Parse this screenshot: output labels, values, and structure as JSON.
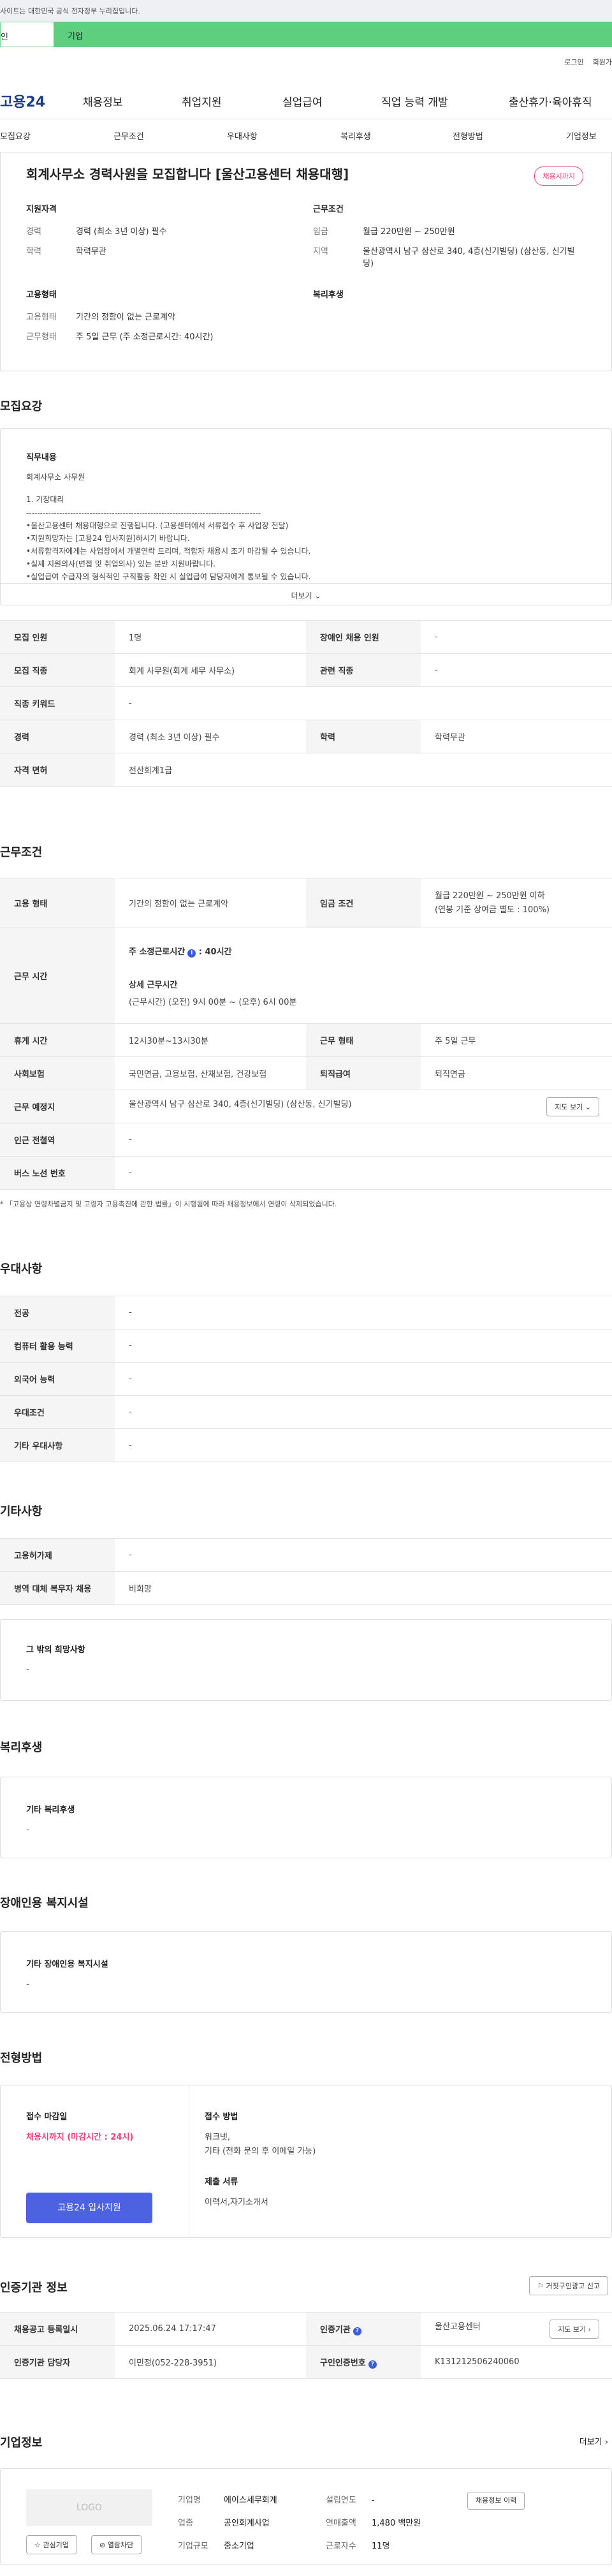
{
  "topbar": {
    "notice": "사이트는 대한민국 공식 전자정부 누리집입니다."
  },
  "tabs": {
    "person": "인",
    "company": "기업"
  },
  "util": {
    "login": "로그인",
    "join": "회원가"
  },
  "gnb": {
    "logo": "고용24",
    "menu": [
      "채용정보",
      "취업지원",
      "실업급여",
      "직업 능력 개발",
      "출산휴가·육아휴직"
    ]
  },
  "subnav": [
    "모집요강",
    "근무조건",
    "우대사항",
    "복리후생",
    "전형방법",
    "기업정보"
  ],
  "summary": {
    "title": "회계사무소 경력사원을 모집합니다 [울산고용센터 채용대행]",
    "badge": "채용시까지",
    "qual": {
      "heading": "지원자격",
      "career_label": "경력",
      "career": "경력 (최소 3년 이상) 필수",
      "edu_label": "학력",
      "edu": "학력무관"
    },
    "cond": {
      "heading": "근무조건",
      "wage_label": "임금",
      "wage": "월급 220만원 ~ 250만원",
      "area_label": "지역",
      "area": "울산광역시 남구 삼산로 340, 4층(신기빌딩) (삼산동, 신기빌딩)"
    },
    "emp": {
      "heading": "고용형태",
      "type_label": "고용형태",
      "type": "기간의 정함이 없는 근로계약",
      "form_label": "근무형태",
      "form": "주 5일 근무 (주 소정근로시간: 40시간)"
    },
    "welfare": {
      "heading": "복리후생"
    }
  },
  "recruit": {
    "title": "모집요강",
    "job_heading": "직무내용",
    "lines": [
      "회계사무소 사무원",
      "1. 기장대리",
      "-------------------------------------------------------------------------------------",
      "•울산고용센터 채용대행으로 진행됩니다. (고용센터에서 서류접수 후 사업장 전달)",
      "•지원희망자는 [고용24 입사지원]하시기 바랍니다.",
      "•서류합격자에게는 사업장에서 개별연락 드리며, 적합자 채용시 조기 마감될 수 있습니다.",
      "•실제 지원의사(면접 및 취업의사) 있는 분만 지원바랍니다.",
      "•실업급여 수급자의 형식적인 구직활동 확인 시 실업급여 담당자에게 통보될 수 있습니다."
    ],
    "more": "더보기",
    "rows": [
      [
        "모집 인원",
        "1명",
        "장애인 채용 인원",
        "-"
      ],
      [
        "모집 직종",
        "회계 사무원(회계 세무 사무소)",
        "관련 직종",
        "-"
      ],
      [
        "직종 키워드",
        "-"
      ],
      [
        "경력",
        "경력 (최소 3년 이상) 필수",
        "학력",
        "학력무관"
      ],
      [
        "자격 면허",
        "전산회계1급"
      ]
    ]
  },
  "work": {
    "title": "근무조건",
    "emp_label": "고용 형태",
    "emp": "기간의 정함이 없는 근로계약",
    "wage_label": "임금 조건",
    "wage": "월급 220만원 ~ 250만원 이하",
    "wage_note": "(연봉 기준 상여금 별도 : 100%)",
    "time_label": "근무 시간",
    "weekly": "주 소정근로시간",
    "weekly_val": ": 40시간",
    "detail_label": "상세 근무시간",
    "detail": "(근무시간) (오전) 9시 00분 ~ (오후) 6시 00분",
    "rest_label": "휴게 시간",
    "rest": "12시30분~13시30분",
    "form_label": "근무 형태",
    "form": "주 5일 근무",
    "ins_label": "사회보험",
    "ins": "국민연금, 고용보험, 산재보험, 건강보험",
    "ret_label": "퇴직급여",
    "ret": "퇴직연금",
    "place_label": "근무 예정지",
    "place": "울산광역시 남구 삼산로 340, 4층(신기빌딩) (삼산동, 신기빌딩)",
    "map": "지도 보기",
    "subway_label": "인근 전철역",
    "subway": "-",
    "bus_label": "버스 노선 번호",
    "bus": "-",
    "footnote": "* 「고용상 연령차별금지 및 고령자 고용촉진에 관한 법률」이 시행됨에 따라 채용정보에서 연령이 삭제되었습니다."
  },
  "pref": {
    "title": "우대사항",
    "rows": [
      [
        "전공",
        "-"
      ],
      [
        "컴퓨터 활용 능력",
        "-"
      ],
      [
        "외국어 능력",
        "-"
      ],
      [
        "우대조건",
        "-"
      ],
      [
        "기타 우대사항",
        "-"
      ]
    ]
  },
  "etc": {
    "title": "기타사항",
    "rows": [
      [
        "고용허가제",
        "-"
      ],
      [
        "병역 대체 복무자 채용",
        "비희망"
      ]
    ],
    "wish_heading": "그 밖의 희망사항",
    "wish": "-"
  },
  "welfare": {
    "title": "복리후생",
    "heading": "기타 복리후생",
    "value": "-"
  },
  "disability": {
    "title": "장애인용 복지시설",
    "heading": "기타 장애인용 복지시설",
    "value": "-"
  },
  "screening": {
    "title": "전형방법",
    "deadline_label": "접수 마감일",
    "deadline": "채용시까지 (마감시간 : 24시)",
    "method_label": "접수 방법",
    "method1": "워크넷,",
    "method2": "기타 (전화 문의 후 이메일 가능)",
    "docs_label": "제출 서류",
    "docs": "이력서,자기소개서",
    "apply": "고용24 입사지원"
  },
  "agency": {
    "title": "인증기관 정보",
    "report": "거짓구인광고 신고",
    "reg_label": "채용공고 등록일시",
    "reg": "2025.06.24 17:17:47",
    "org_label": "인증기관",
    "org": "울산고용센터",
    "map": "지도 보기",
    "mgr_label": "인증기관 담당자",
    "mgr": "이민정(052-228-3951)",
    "no_label": "구인인증번호",
    "no": "K131212506240060"
  },
  "company": {
    "title": "기업정보",
    "more": "더보기",
    "logo": "LOGO",
    "fav": "관심기업",
    "block": "열람차단",
    "name_label": "기업명",
    "name": "에이스세무회계",
    "year_label": "설립연도",
    "year": "-",
    "hist_btn": "채용정보 이력",
    "ind_label": "업종",
    "ind": "공인회계사업",
    "sales_label": "연매출액",
    "sales": "1,480 백만원",
    "size_label": "기업규모",
    "size": "중소기업",
    "emp_label": "근로자수",
    "emp": "11명"
  }
}
